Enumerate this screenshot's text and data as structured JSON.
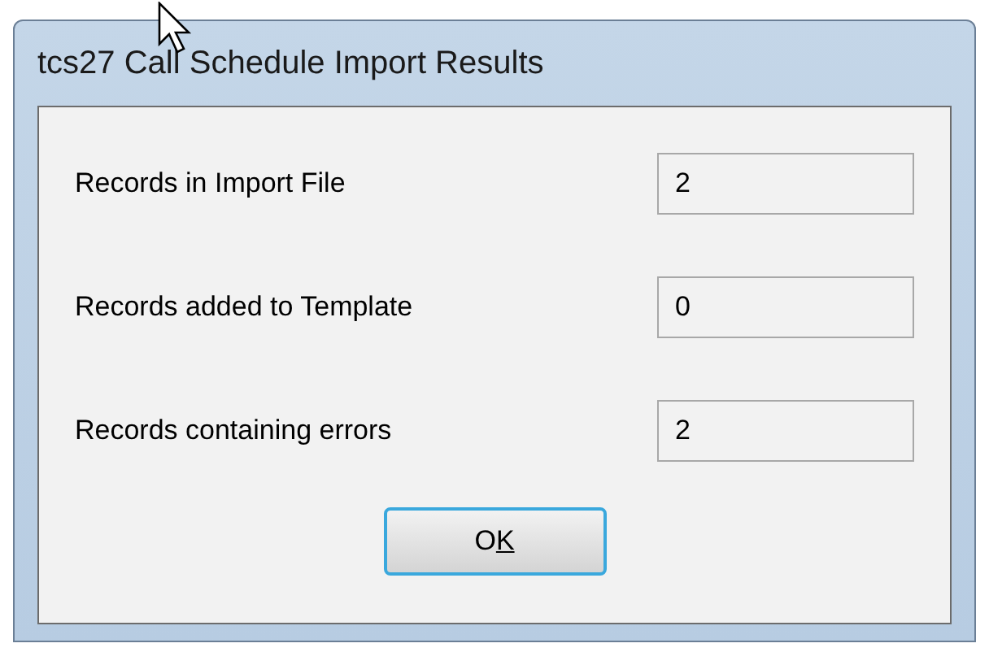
{
  "window": {
    "title": "tcs27 Call Schedule Import Results"
  },
  "fields": [
    {
      "label": "Records in Import File",
      "value": "2"
    },
    {
      "label": "Records added to Template",
      "value": "0"
    },
    {
      "label": "Records containing errors",
      "value": "2"
    }
  ],
  "buttons": [
    {
      "label": "OK",
      "focused": true
    }
  ]
}
